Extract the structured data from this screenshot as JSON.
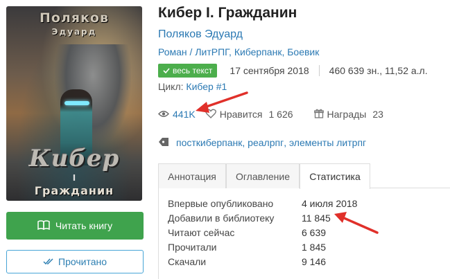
{
  "cover": {
    "author_top": "Поляков",
    "author_sub": "Эдуард",
    "title": "Кибер",
    "roman": "I",
    "subtitle": "Гражданин"
  },
  "buttons": {
    "read_label": "Читать книгу",
    "read_icon": "open-book-icon",
    "done_label": "Прочитано",
    "done_icon": "double-check-icon"
  },
  "book": {
    "title": "Кибер I. Гражданин",
    "author": "Поляков Эдуард",
    "genres": [
      "Роман",
      "ЛитРПГ",
      "Киберпанк",
      "Боевик"
    ],
    "badge": "весь текст",
    "date": "17 сентября 2018",
    "size": "460 639 зн., 11,52 а.л.",
    "cycle_label": "Цикл:",
    "cycle_value": "Кибер #1"
  },
  "stats": {
    "views": "441K",
    "likes_label": "Нравится",
    "likes_value": "1 626",
    "awards_label": "Награды",
    "awards_value": "23"
  },
  "tags": [
    "посткиберпанк",
    "реалрпг",
    "элементы литрпг"
  ],
  "tabs": {
    "annotation": "Аннотация",
    "contents": "Оглавление",
    "statistics": "Статистика",
    "active": "Статистика"
  },
  "statistics": [
    {
      "label": "Впервые опубликовано",
      "value": "4 июля 2018"
    },
    {
      "label": "Добавили в библиотеку",
      "value": "11 845"
    },
    {
      "label": "Читают сейчас",
      "value": "6 639"
    },
    {
      "label": "Прочитали",
      "value": "1 845"
    },
    {
      "label": "Скачали",
      "value": "9 146"
    }
  ],
  "colors": {
    "link": "#2b79b3",
    "read_button": "#3fa34d",
    "badge": "#4cae4c",
    "annotation_arrow": "#e0302a"
  }
}
